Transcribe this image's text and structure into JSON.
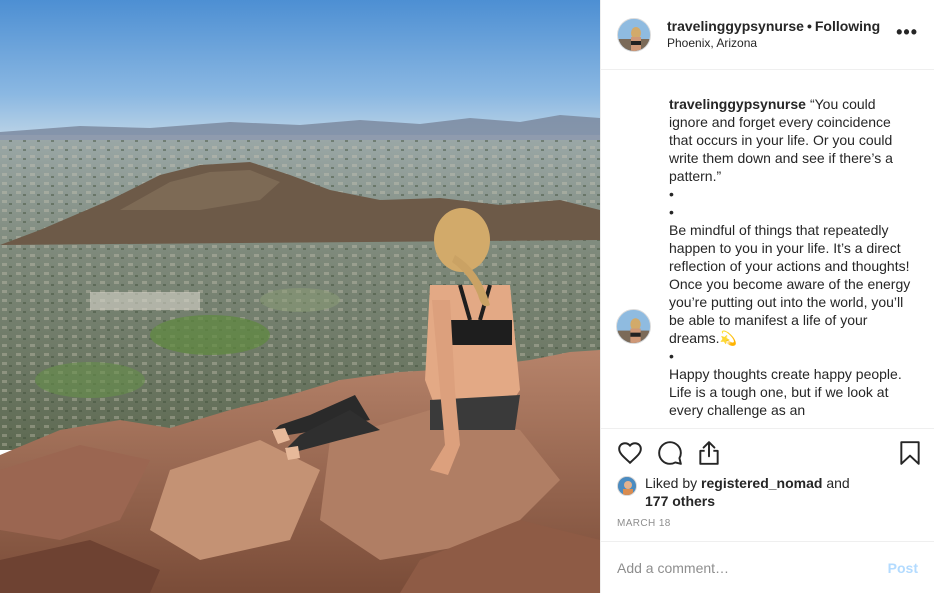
{
  "post": {
    "username": "travelinggypsynurse",
    "separator": "•",
    "follow_status": "Following",
    "location": "Phoenix, Arizona",
    "more_icon": "more-horizontal-icon"
  },
  "caption": {
    "username": "travelinggypsynurse",
    "line_quote": "“You could ignore and forget every coincidence that occurs in your life. Or you could write them down and see if there’s a pattern.”",
    "bullet1": "•",
    "bullet2": "•",
    "paragraph2": "Be mindful of things that repeatedly happen to you in your life. It’s a direct reflection of your actions and thoughts! Once you become aware of the energy you’re putting out into the world, you’ll be able to manifest a life of your dreams.",
    "emoji": "💫",
    "bullet3": "•",
    "paragraph3": "Happy thoughts create happy people. Life is a tough one, but if we look at every challenge as an"
  },
  "actions": {
    "like_icon": "heart-icon",
    "comment_icon": "comment-icon",
    "share_icon": "share-icon",
    "save_icon": "bookmark-icon"
  },
  "likes": {
    "prefix": "Liked by",
    "user": "registered_nomad",
    "and": "and",
    "others": "177 others"
  },
  "date": "MARCH 18",
  "comment": {
    "placeholder": "Add a comment…",
    "post_label": "Post"
  },
  "colors": {
    "text": "#262626",
    "muted": "#8e8e8e",
    "post_button_disabled": "#b3dbff",
    "divider": "#efefef"
  }
}
